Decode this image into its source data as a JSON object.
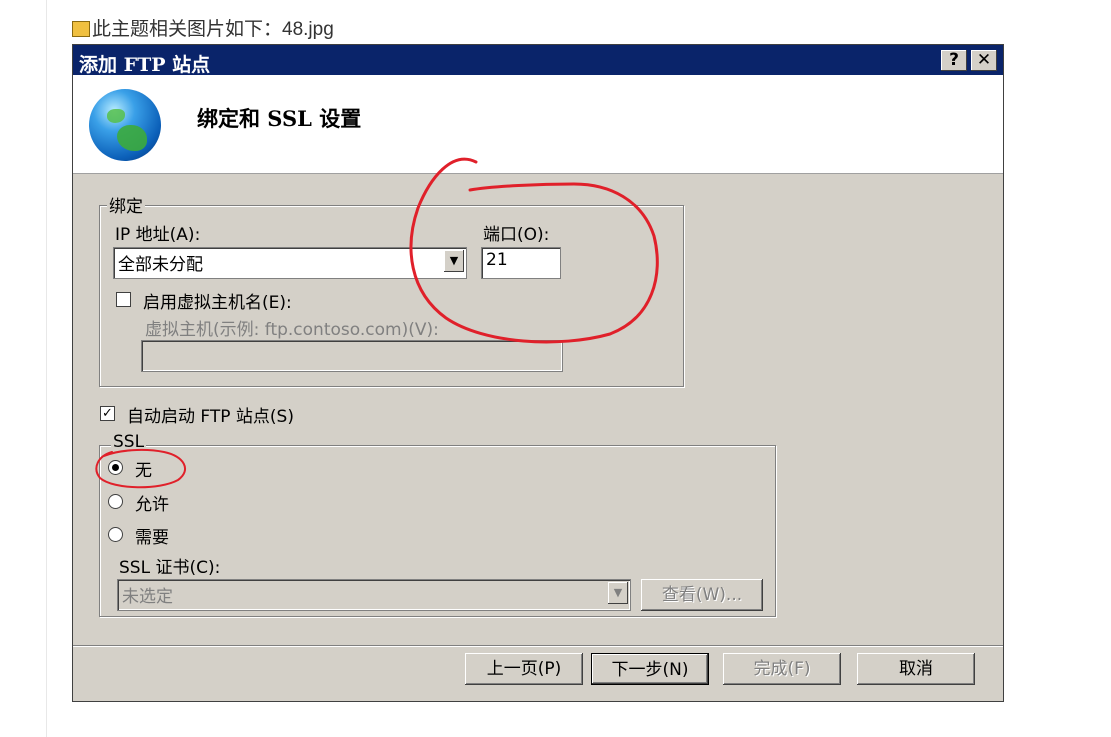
{
  "caption": "此主题相关图片如下：48.jpg",
  "dialog": {
    "title": "添加 FTP 站点",
    "help_label": "?",
    "close_label": "✕",
    "heading": "绑定和 SSL 设置",
    "binding": {
      "legend": "绑定",
      "ip_label": "IP 地址(A):",
      "ip_value": "全部未分配",
      "port_label": "端口(O):",
      "port_value": "21",
      "vhost_checkbox_label": "启用虚拟主机名(E):",
      "vhost_hint": "虚拟主机(示例: ftp.contoso.com)(V):",
      "vhost_value": ""
    },
    "autostart_label": "自动启动 FTP 站点(S)",
    "ssl": {
      "legend": "SSL",
      "option_none": "无",
      "option_allow": "允许",
      "option_require": "需要",
      "cert_label": "SSL 证书(C):",
      "cert_value": "未选定",
      "view_button": "查看(W)..."
    },
    "buttons": {
      "prev": "上一页(P)",
      "next": "下一步(N)",
      "finish": "完成(F)",
      "cancel": "取消"
    }
  },
  "colors": {
    "titlebar": "#0a246a",
    "dialog_bg": "#d4d0c8",
    "annotation": "#e0202a"
  }
}
